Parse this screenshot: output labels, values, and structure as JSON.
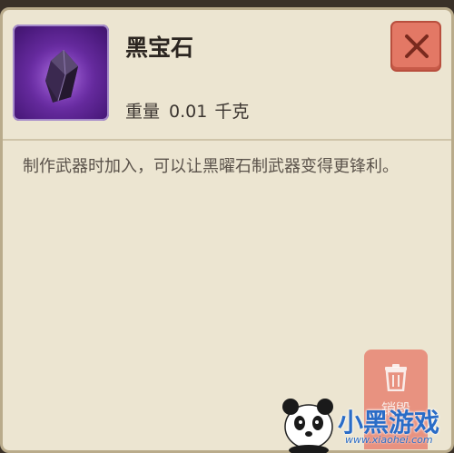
{
  "item": {
    "name": "黑宝石",
    "weight_label": "重量",
    "weight_value": "0.01",
    "weight_unit": "千克",
    "icon": "black-gem-icon",
    "description": "制作武器时加入，可以让黑曜石制武器变得更锋利。"
  },
  "buttons": {
    "close_icon": "close-icon",
    "discard_label": "销毁",
    "discard_icon": "trash-icon"
  },
  "watermark": {
    "text": "小黑游戏",
    "url": "www.xiaohei.com"
  },
  "colors": {
    "panel_bg": "#ece5d1",
    "border": "#b9ab8b",
    "close_button": "#e37865",
    "discard_button": "#e88977",
    "gem_bg": "#6a2da3"
  }
}
